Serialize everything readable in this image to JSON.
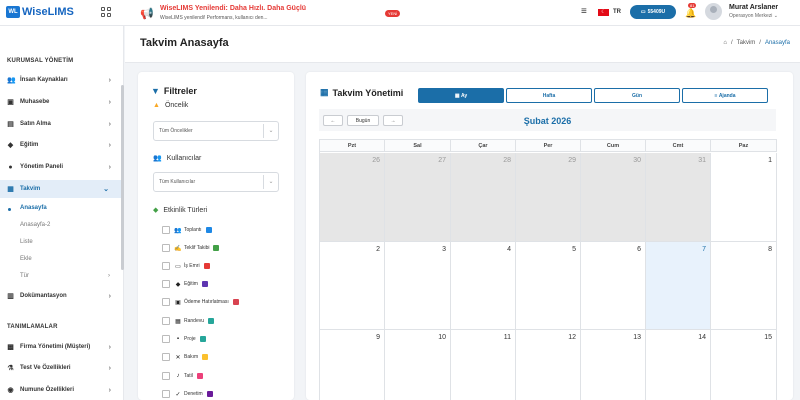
{
  "app": {
    "logo_badge": "WL",
    "logo_text": "WiseLIMS"
  },
  "announcement": {
    "title": "WiseLIMS Yenilendi: Daha Hızlı. Daha Güçlü",
    "subtitle": "WiseLIMS yenilendi! Performans, kullanıcı den...",
    "badge": "YENİ"
  },
  "topbar": {
    "lang": "TR",
    "ip": "55409U",
    "notif_count": "81"
  },
  "user": {
    "name": "Murat Arslaner",
    "role": "Operasyon Merkezi"
  },
  "sidebar": {
    "section1": "KURUMSAL YÖNETİM",
    "items1": [
      {
        "label": "İnsan Kaynakları",
        "icon": "users-icon"
      },
      {
        "label": "Muhasebe",
        "icon": "wallet-icon"
      },
      {
        "label": "Satın Alma",
        "icon": "cart-icon"
      },
      {
        "label": "Eğitim",
        "icon": "education-icon"
      },
      {
        "label": "Yönetim Paneli",
        "icon": "dashboard-icon"
      },
      {
        "label": "Takvim",
        "icon": "calendar-icon"
      }
    ],
    "sub": [
      "Anasayfa",
      "Anasayfa-2",
      "Liste",
      "Ekle",
      "Tür"
    ],
    "after": {
      "label": "Dokümantasyon",
      "icon": "document-icon"
    },
    "section2": "TANIMLAMALAR",
    "items2": [
      {
        "label": "Firma Yönetimi (Müşteri)",
        "icon": "building-icon"
      },
      {
        "label": "Test Ve Özellikleri",
        "icon": "flask-icon"
      },
      {
        "label": "Numune Özellikleri",
        "icon": "sample-icon"
      }
    ]
  },
  "page": {
    "title": "Takvim Anasayfa",
    "breadcrumb": [
      "Takvim",
      "Anasayfa"
    ]
  },
  "filters": {
    "title": "Filtreler",
    "priority_label": "Öncelik",
    "priority_value": "Tüm Öncelikler",
    "users_label": "Kullanıcılar",
    "users_value": "Tüm Kullanıcılar",
    "types_label": "Etkinlik Türleri",
    "types": [
      {
        "label": "Toplantı",
        "color": "#1e88e5"
      },
      {
        "label": "Teklif Takibi",
        "color": "#43a047"
      },
      {
        "label": "İş Emri",
        "color": "#e53935"
      },
      {
        "label": "Eğitim",
        "color": "#5e35b1"
      },
      {
        "label": "Ödeme Hatırlatması",
        "color": "#d84350"
      },
      {
        "label": "Randevu",
        "color": "#26a69a"
      },
      {
        "label": "Proje",
        "color": "#26a69a"
      },
      {
        "label": "Bakım",
        "color": "#fbc02d"
      },
      {
        "label": "Tatil",
        "color": "#ec407a"
      },
      {
        "label": "Denetim",
        "color": "#6a1b9a"
      }
    ]
  },
  "calendar": {
    "title": "Takvim Yönetimi",
    "views": [
      "Ay",
      "Hafta",
      "Gün",
      "Ajanda"
    ],
    "active_view": "Ay",
    "today_label": "Bugün",
    "month": "Şubat 2026",
    "weekdays": [
      "Pzt",
      "Sal",
      "Çar",
      "Per",
      "Cum",
      "Cmt",
      "Paz"
    ],
    "rows": [
      [
        "26",
        "27",
        "28",
        "29",
        "30",
        "31",
        "1"
      ],
      [
        "2",
        "3",
        "4",
        "5",
        "6",
        "7",
        "8"
      ],
      [
        "9",
        "10",
        "11",
        "12",
        "13",
        "14",
        "15"
      ]
    ],
    "other_month_cells": 6,
    "today": "7"
  }
}
